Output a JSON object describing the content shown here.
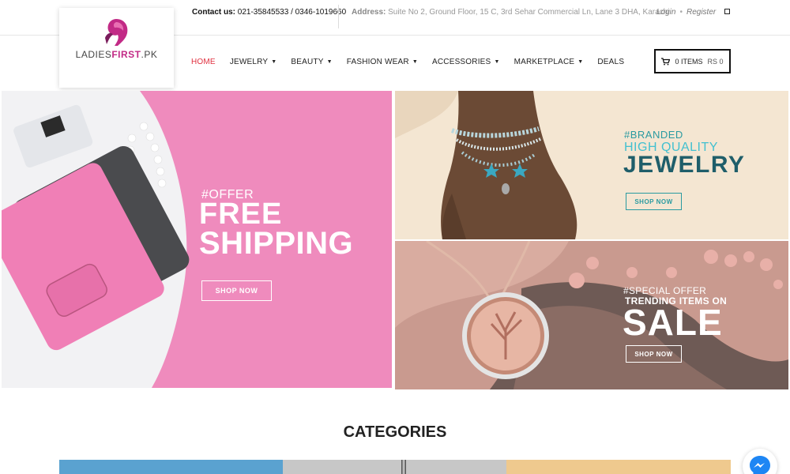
{
  "topbar": {
    "contact_label": "Contact us:",
    "contact_value": "021-35845533 / 0346-1019660",
    "address_label": "Address:",
    "address_value": "Suite No 2, Ground Floor, 15 C, 3rd Sehar Commercial Ln, Lane 3 DHA, Karachi",
    "login": "Login",
    "register": "Register"
  },
  "logo": {
    "part1": "LADIES",
    "part2": "FIRST",
    "part3": ".PK"
  },
  "nav": {
    "items": [
      {
        "label": "HOME",
        "active": true,
        "caret": false
      },
      {
        "label": "JEWELRY",
        "active": false,
        "caret": true
      },
      {
        "label": "BEAUTY",
        "active": false,
        "caret": true
      },
      {
        "label": "FASHION WEAR",
        "active": false,
        "caret": true
      },
      {
        "label": "ACCESSORIES",
        "active": false,
        "caret": true
      },
      {
        "label": "MARKETPLACE",
        "active": false,
        "caret": true
      },
      {
        "label": "DEALS",
        "active": false,
        "caret": false
      }
    ]
  },
  "cart": {
    "items": "0 ITEMS",
    "price": "RS 0",
    "icon": "cart-icon"
  },
  "banners": {
    "shipping": {
      "tag": "#OFFER",
      "line1": "FREE",
      "line2": "SHIPPING",
      "button": "SHOP NOW"
    },
    "jewelry": {
      "tag": "#BRANDED",
      "line1": "HIGH QUALITY",
      "line2": "JEWELRY",
      "button": "SHOP NOW"
    },
    "sale": {
      "tag": "#SPECIAL OFFER",
      "line1": "TRENDING ITEMS ON",
      "line2": "SALE",
      "button": "SHOP NOW"
    }
  },
  "categories": {
    "title": "CATEGORIES"
  },
  "colors": {
    "accent": "#e0303f",
    "brand": "#c22a86",
    "pink_banner": "#ef8bbd",
    "teal": "#1f5e6a"
  }
}
